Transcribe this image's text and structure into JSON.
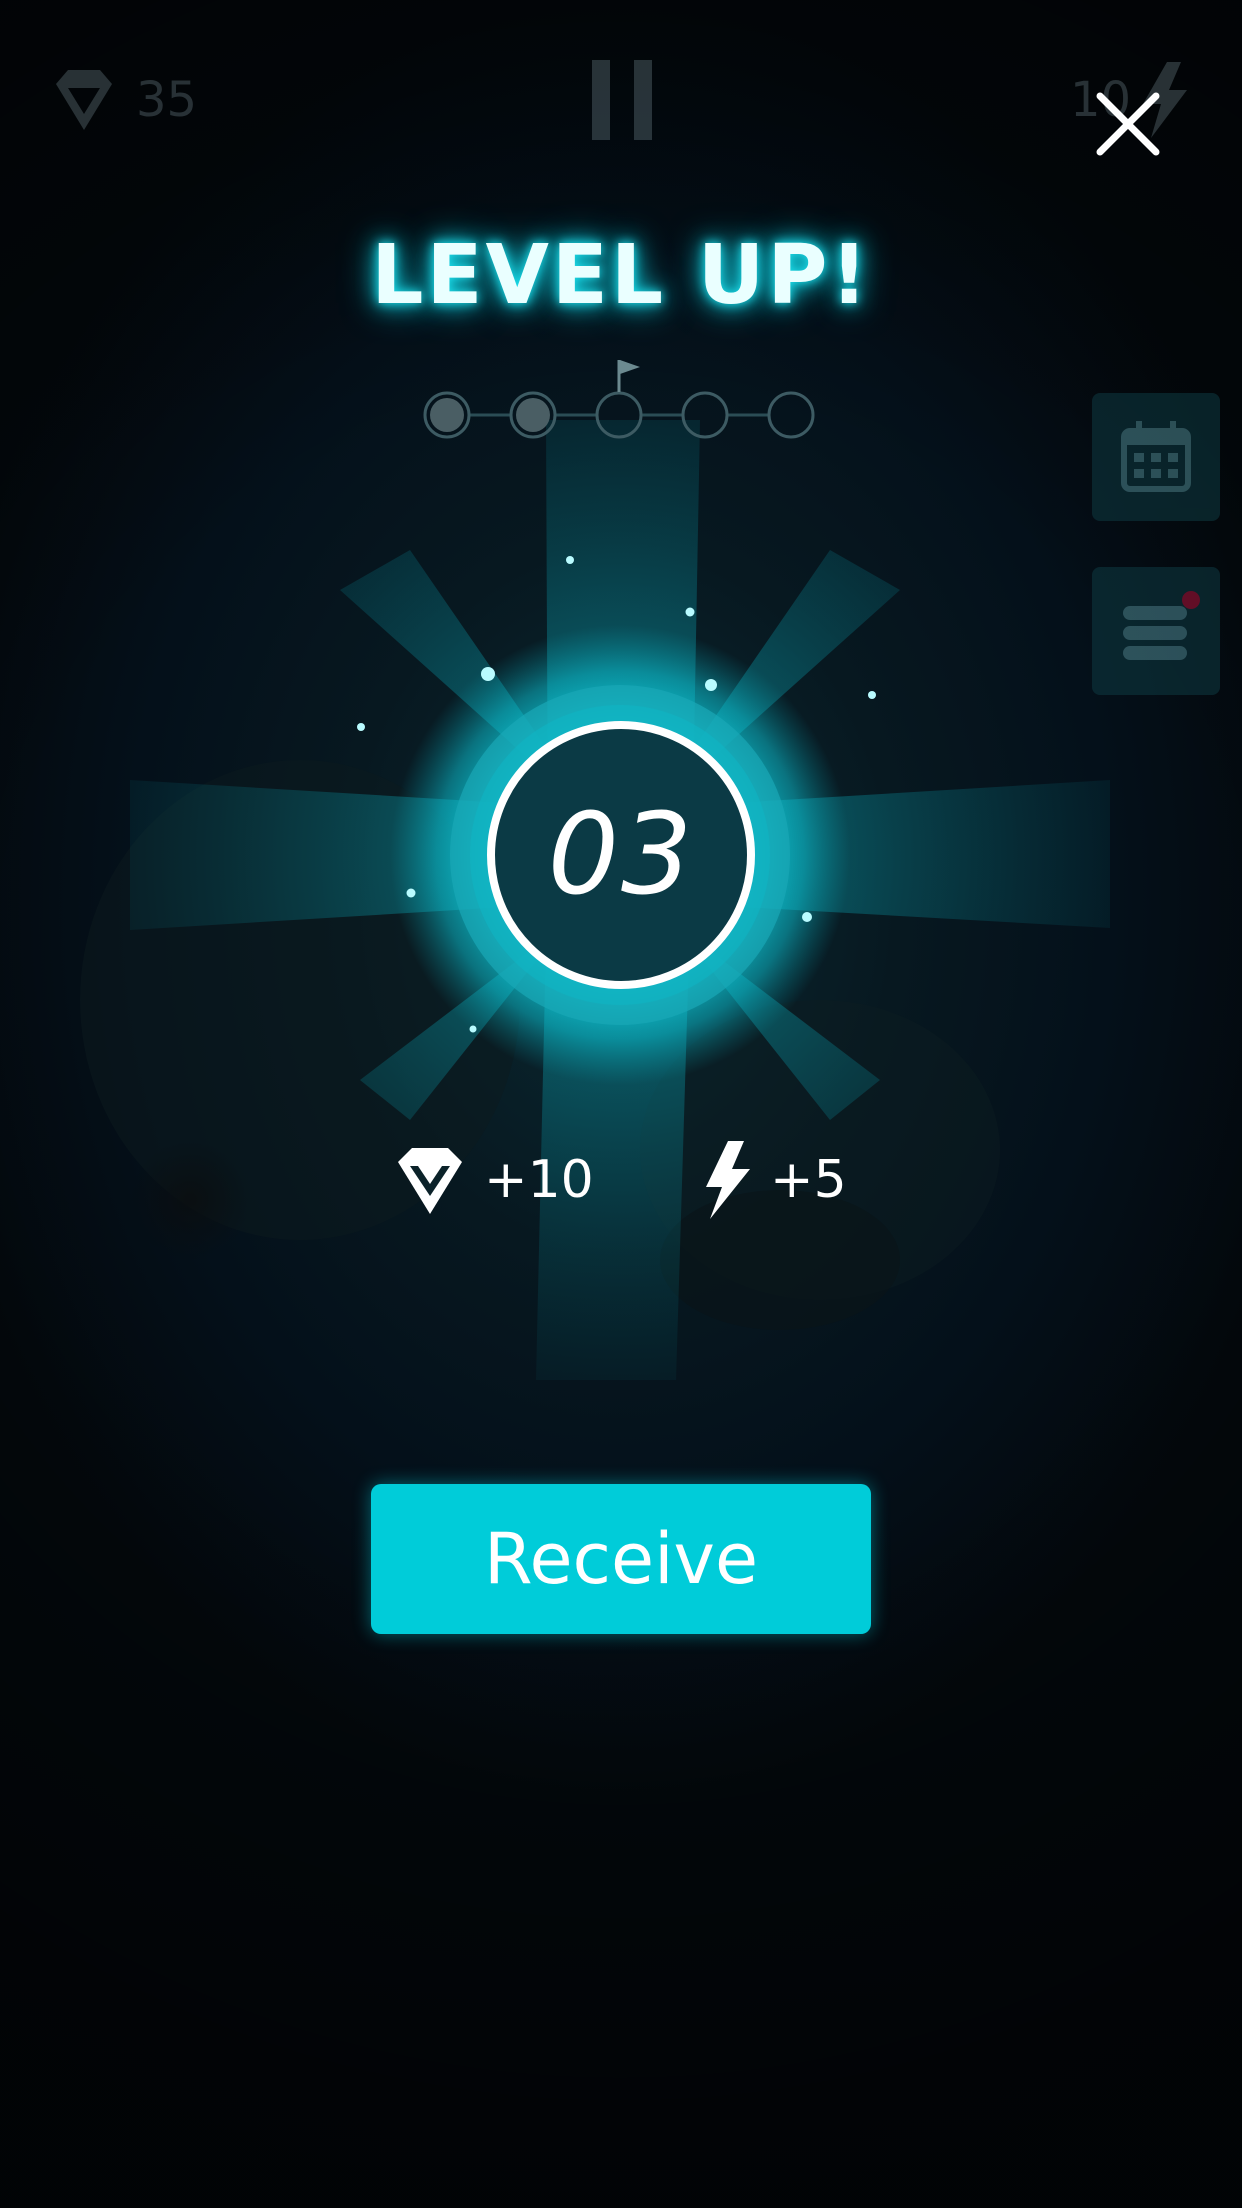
{
  "hud": {
    "gems_count": "35",
    "energy_count": "10"
  },
  "popup": {
    "title": "LEVEL UP!",
    "level_number": "03",
    "progress": {
      "total_steps": 5,
      "completed_steps": 2,
      "flag_step": 3
    },
    "rewards": [
      {
        "icon": "diamond-icon",
        "amount": "+10"
      },
      {
        "icon": "lightning-icon",
        "amount": "+5"
      }
    ],
    "receive_label": "Receive"
  },
  "side_buttons": [
    {
      "icon": "calendar-icon"
    },
    {
      "icon": "list-icon",
      "has_notification": true
    }
  ],
  "colors": {
    "accent": "#00ccd9",
    "glow": "#1ee3f0",
    "badge_fill": "#0b3a45",
    "notification": "#b0123a"
  }
}
